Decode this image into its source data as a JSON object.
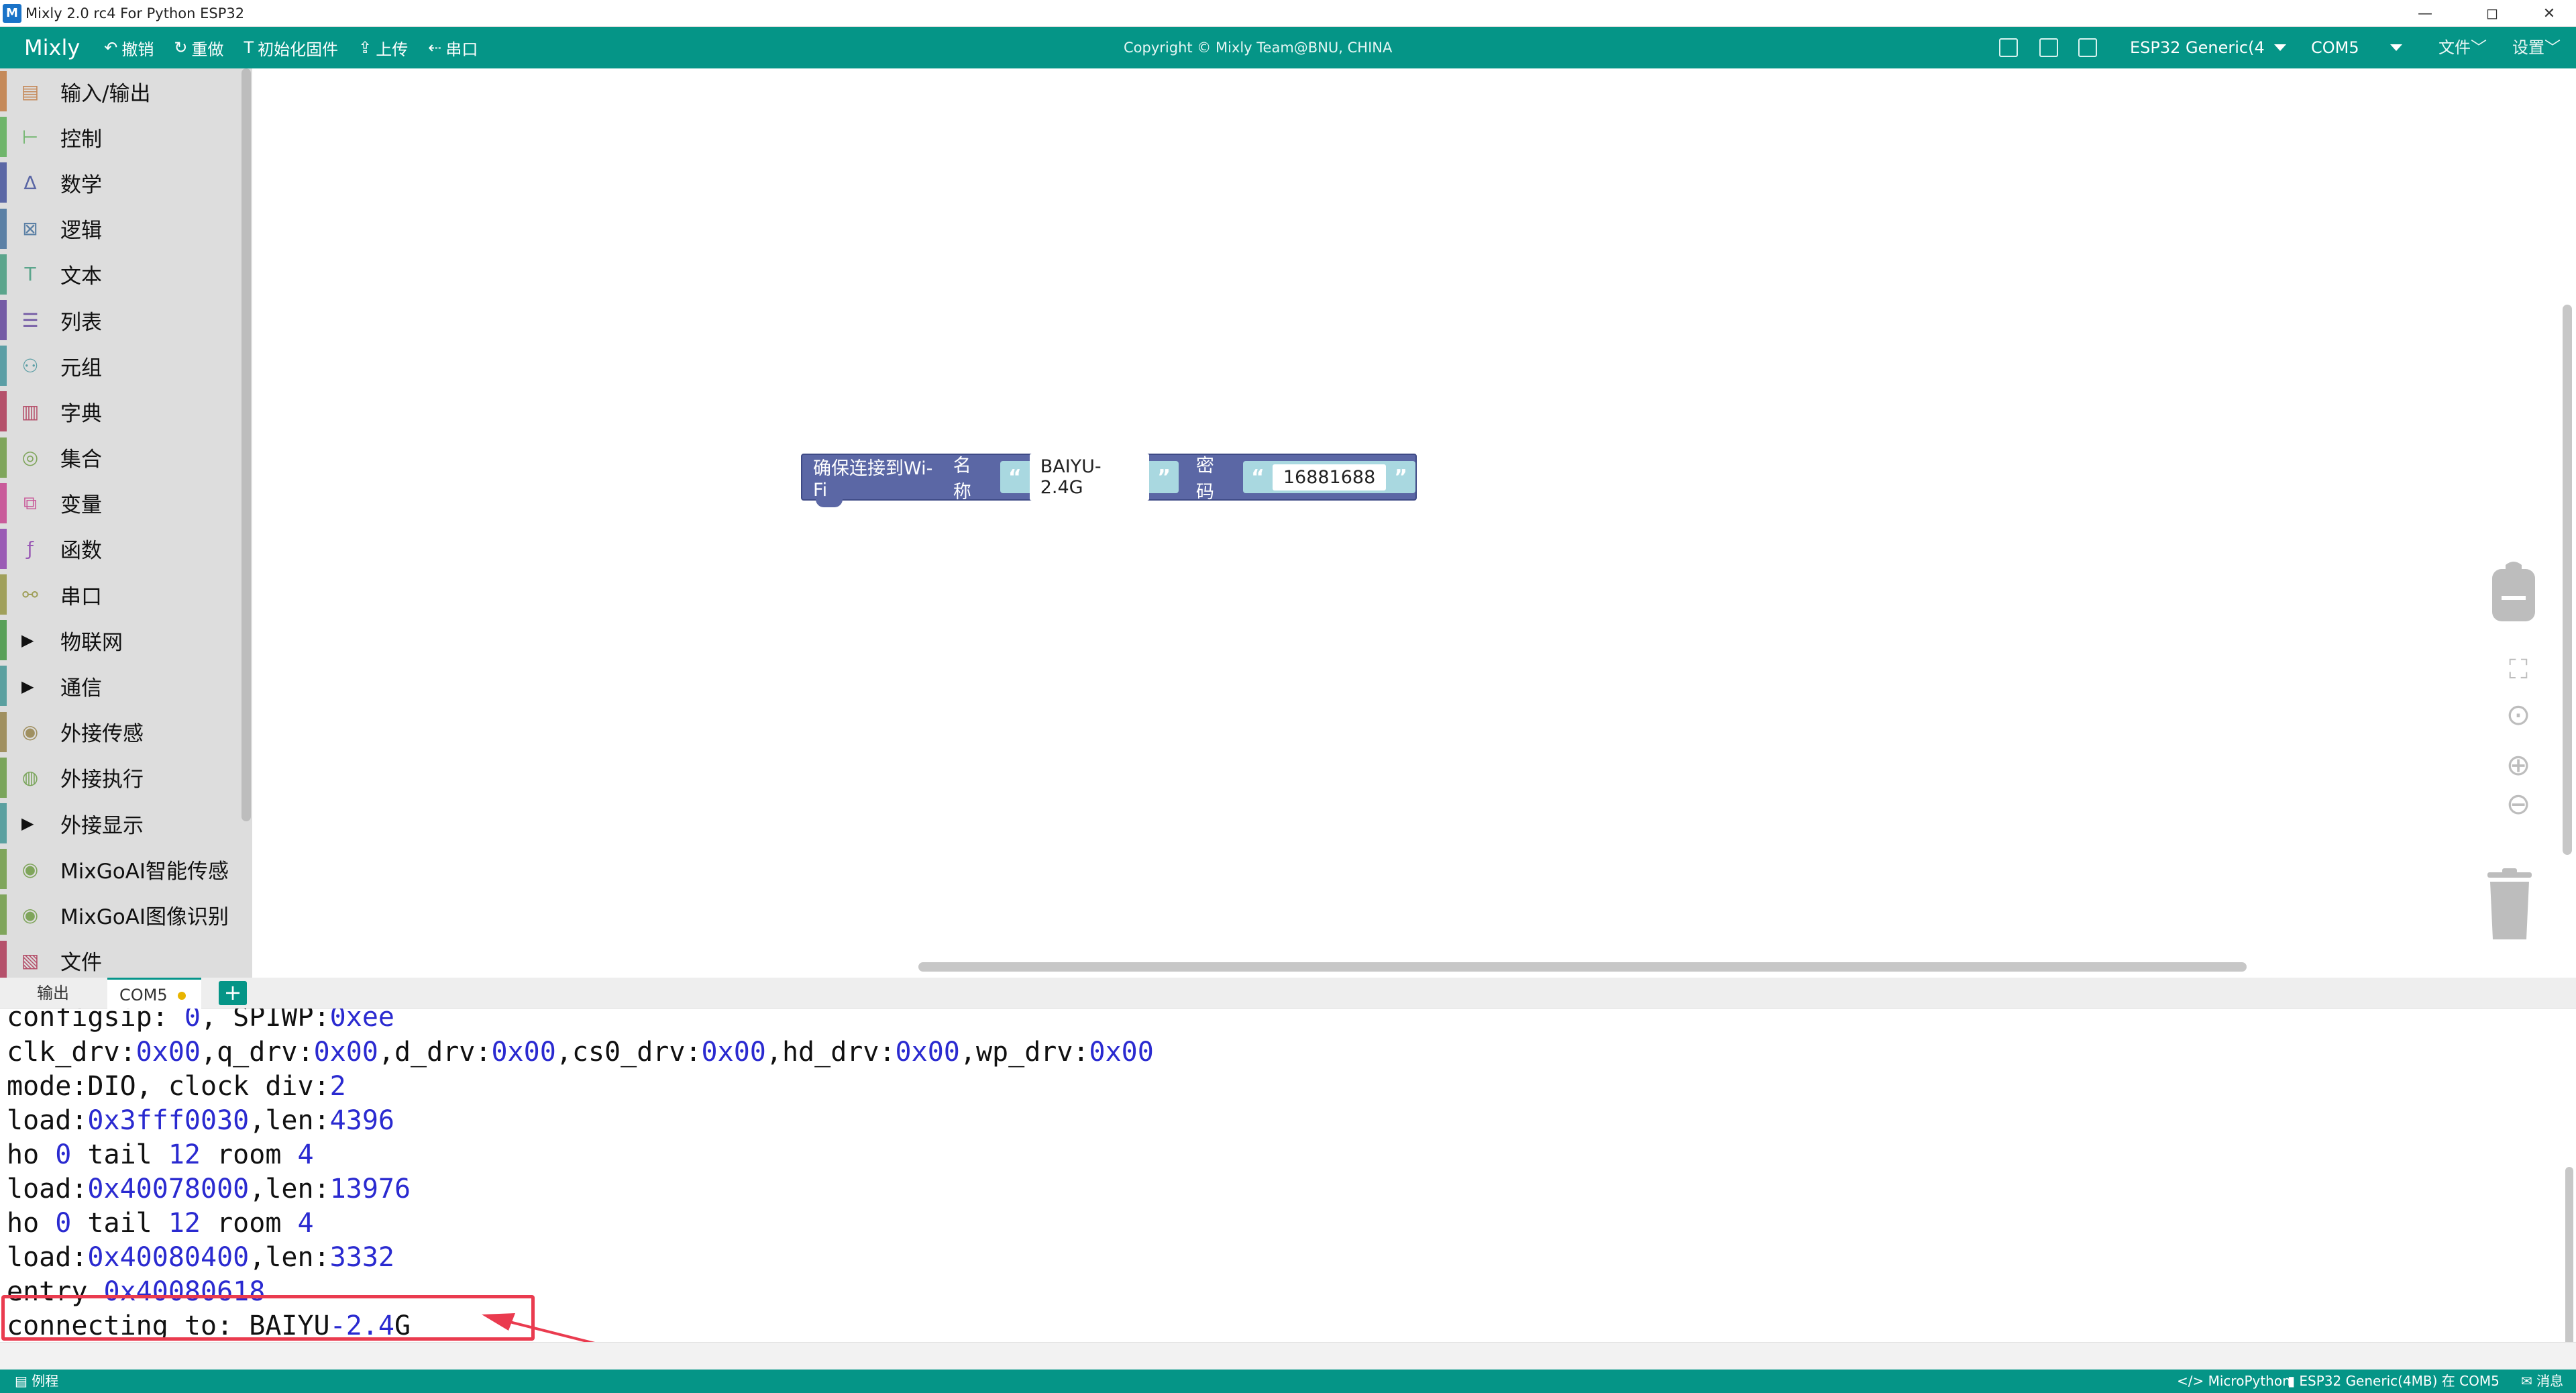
{
  "window": {
    "title": "Mixly 2.0 rc4 For Python ESP32",
    "logo": "M",
    "controls": [
      "—",
      "◻",
      "✕"
    ]
  },
  "header": {
    "brand": "Mixly",
    "toolbar": [
      {
        "icon": "undo-icon",
        "glyph": "↶",
        "label": "撤销"
      },
      {
        "icon": "redo-icon",
        "glyph": "↻",
        "label": "重做"
      },
      {
        "icon": "firmware-icon",
        "glyph": "T",
        "label": "初始化固件"
      },
      {
        "icon": "upload-icon",
        "glyph": "⇪",
        "label": "上传"
      },
      {
        "icon": "serial-icon",
        "glyph": "⇠",
        "label": "串口"
      }
    ],
    "copyright": "Copyright © Mixly Team@BNU, CHINA",
    "board": "ESP32 Generic(4",
    "port": "COM5",
    "file_menu": "文件﹀",
    "settings_menu": "设置﹀"
  },
  "sidebar": {
    "categories": [
      {
        "label": "输入/输出",
        "color": "#c58a5a",
        "icon": "io-icon",
        "glyph": "▤",
        "expandable": false
      },
      {
        "label": "控制",
        "color": "#6fb56b",
        "icon": "control-icon",
        "glyph": "⊢",
        "expandable": false
      },
      {
        "label": "数学",
        "color": "#5b67a5",
        "icon": "math-icon",
        "glyph": "∆",
        "expandable": false
      },
      {
        "label": "逻辑",
        "color": "#5b80a5",
        "icon": "logic-icon",
        "glyph": "⊠",
        "expandable": false
      },
      {
        "label": "文本",
        "color": "#5ba58c",
        "icon": "text-icon",
        "glyph": "T",
        "expandable": false
      },
      {
        "label": "列表",
        "color": "#745ba5",
        "icon": "list-icon",
        "glyph": "☰",
        "expandable": false
      },
      {
        "label": "元组",
        "color": "#5b9ea5",
        "icon": "tuple-icon",
        "glyph": "⚇",
        "expandable": false
      },
      {
        "label": "字典",
        "color": "#b5516b",
        "icon": "dict-icon",
        "glyph": "▥",
        "expandable": false
      },
      {
        "label": "集合",
        "color": "#7fa55b",
        "icon": "set-icon",
        "glyph": "◎",
        "expandable": false
      },
      {
        "label": "变量",
        "color": "#c95b9a",
        "icon": "variable-icon",
        "glyph": "⧉",
        "expandable": false
      },
      {
        "label": "函数",
        "color": "#9a5bb5",
        "icon": "function-icon",
        "glyph": "ƒ",
        "expandable": false
      },
      {
        "label": "串口",
        "color": "#a0a05b",
        "icon": "serial-port-icon",
        "glyph": "⚯",
        "expandable": false
      },
      {
        "label": "物联网",
        "color": "#58a058",
        "icon": "",
        "glyph": "",
        "expandable": true
      },
      {
        "label": "通信",
        "color": "#5ba0a0",
        "icon": "",
        "glyph": "",
        "expandable": true
      },
      {
        "label": "外接传感",
        "color": "#a09060",
        "icon": "sensor-icon",
        "glyph": "◉",
        "expandable": false
      },
      {
        "label": "外接执行",
        "color": "#7aa55b",
        "icon": "actuator-icon",
        "glyph": "◍",
        "expandable": false
      },
      {
        "label": "外接显示",
        "color": "#5ba0a0",
        "icon": "",
        "glyph": "",
        "expandable": true
      },
      {
        "label": "MixGoAI智能传感",
        "color": "#7fa55b",
        "icon": "ai-sensor-icon",
        "glyph": "◉",
        "expandable": false
      },
      {
        "label": "MixGoAI图像识别",
        "color": "#7fa55b",
        "icon": "ai-vision-icon",
        "glyph": "◉",
        "expandable": false
      },
      {
        "label": "文件",
        "color": "#b5516b",
        "icon": "file-icon",
        "glyph": "▧",
        "expandable": false
      }
    ]
  },
  "block": {
    "label": "确保连接到Wi-Fi",
    "name_label": "名称",
    "ssid": "BAIYU-2.4G",
    "password_label": "密码",
    "password": "16881688",
    "quote_open": "“",
    "quote_close": "”"
  },
  "tabs": {
    "output": "输出",
    "com5": "COM5",
    "close": "✕",
    "add": "+"
  },
  "console": {
    "lines": [
      [
        {
          "t": "configsip: "
        },
        {
          "t": "0",
          "h": true
        },
        {
          "t": ", SPIWP:"
        },
        {
          "t": "0xee",
          "h": true
        }
      ],
      [
        {
          "t": "clk_drv:"
        },
        {
          "t": "0x00",
          "h": true
        },
        {
          "t": ",q_drv:"
        },
        {
          "t": "0x00",
          "h": true
        },
        {
          "t": ",d_drv:"
        },
        {
          "t": "0x00",
          "h": true
        },
        {
          "t": ",cs0_drv:"
        },
        {
          "t": "0x00",
          "h": true
        },
        {
          "t": ",hd_drv:"
        },
        {
          "t": "0x00",
          "h": true
        },
        {
          "t": ",wp_drv:"
        },
        {
          "t": "0x00",
          "h": true
        }
      ],
      [
        {
          "t": "mode:DIO, clock div:"
        },
        {
          "t": "2",
          "h": true
        }
      ],
      [
        {
          "t": "load:"
        },
        {
          "t": "0x3fff0030",
          "h": true
        },
        {
          "t": ",len:"
        },
        {
          "t": "4396",
          "h": true
        }
      ],
      [
        {
          "t": "ho "
        },
        {
          "t": "0",
          "h": true
        },
        {
          "t": " tail "
        },
        {
          "t": "12",
          "h": true
        },
        {
          "t": " room "
        },
        {
          "t": "4",
          "h": true
        }
      ],
      [
        {
          "t": "load:"
        },
        {
          "t": "0x40078000",
          "h": true
        },
        {
          "t": ",len:"
        },
        {
          "t": "13976",
          "h": true
        }
      ],
      [
        {
          "t": "ho "
        },
        {
          "t": "0",
          "h": true
        },
        {
          "t": " tail "
        },
        {
          "t": "12",
          "h": true
        },
        {
          "t": " room "
        },
        {
          "t": "4",
          "h": true
        }
      ],
      [
        {
          "t": "load:"
        },
        {
          "t": "0x40080400",
          "h": true
        },
        {
          "t": ",len:"
        },
        {
          "t": "3332",
          "h": true
        }
      ],
      [
        {
          "t": "entry "
        },
        {
          "t": "0x40080618",
          "h": true
        }
      ],
      [
        {
          "t": "connecting to: BAIYU"
        },
        {
          "t": "-2.4",
          "h": true
        },
        {
          "t": "G"
        }
      ]
    ]
  },
  "statusbar": {
    "left": "▤ 例程",
    "language": "</> MicroPython",
    "board_status": "▮ ESP32 Generic(4MB) 在 COM5",
    "message": "✉ 消息"
  },
  "colors": {
    "primary": "#059587",
    "block": "#5b67a5",
    "string_block": "#a9d8e0",
    "highlight_box": "#ea3b4f",
    "console_number": "#2a2ad0"
  }
}
